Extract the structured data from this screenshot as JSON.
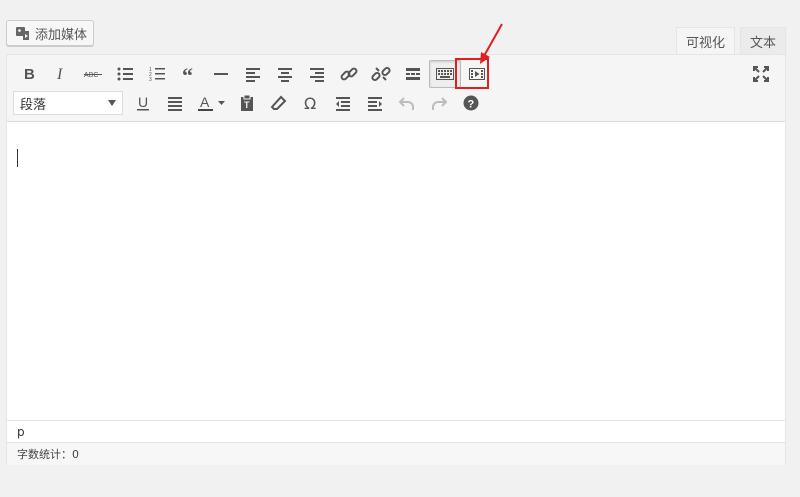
{
  "media_button": {
    "label": "添加媒体",
    "icon": "media-icon"
  },
  "tabs": [
    {
      "label": "可视化",
      "active": true
    },
    {
      "label": "文本",
      "active": false
    }
  ],
  "toolbar": {
    "row1": [
      "bold-icon",
      "italic-icon",
      "strikethrough-icon",
      "bullet-list-icon",
      "numbered-list-icon",
      "blockquote-icon",
      "horizontal-rule-icon",
      "align-left-icon",
      "align-center-icon",
      "align-right-icon",
      "link-icon",
      "unlink-icon",
      "read-more-icon",
      "toolbar-toggle-icon",
      "video-insert-icon"
    ],
    "row2_format_select": "段落",
    "fullscreen_icon": "fullscreen-icon"
  },
  "status": {
    "path": "p",
    "word_count": "字数统计：0"
  },
  "colors": {
    "highlight": "#e02020",
    "text_color_underline": "#444444"
  }
}
